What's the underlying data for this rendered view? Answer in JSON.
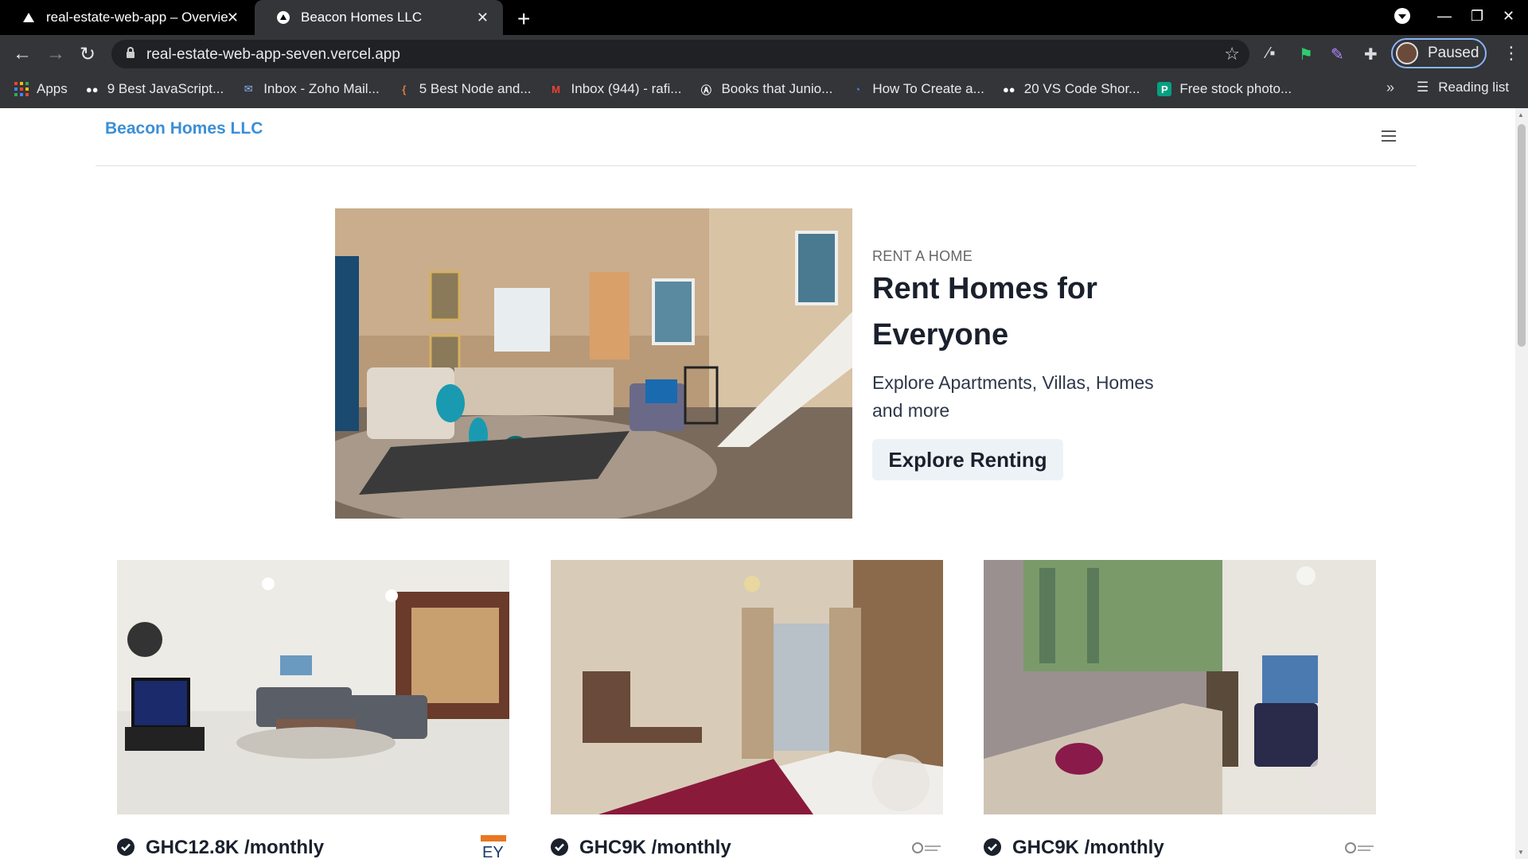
{
  "browser": {
    "tabs": [
      {
        "title": "real-estate-web-app – Overvie",
        "active": false
      },
      {
        "title": "Beacon Homes LLC",
        "active": true
      }
    ],
    "url": "real-estate-web-app-seven.vercel.app",
    "profile_label": "Paused",
    "bookmarks": [
      {
        "label": "Apps",
        "icon": "apps-grid-icon"
      },
      {
        "label": "9 Best JavaScript...",
        "icon": "medium-icon"
      },
      {
        "label": "Inbox - Zoho Mail...",
        "icon": "zoho-mail-icon"
      },
      {
        "label": "5 Best Node and...",
        "icon": "bookmark-icon"
      },
      {
        "label": "Inbox (944) - rafi...",
        "icon": "gmail-icon"
      },
      {
        "label": "Books that Junio...",
        "icon": "site-icon"
      },
      {
        "label": "How To Create a...",
        "icon": "site-icon"
      },
      {
        "label": "20 VS Code Shor...",
        "icon": "medium-icon"
      },
      {
        "label": "Free stock photo...",
        "icon": "pexels-icon"
      }
    ],
    "reading_list": "Reading list"
  },
  "site": {
    "brand": "Beacon Homes LLC",
    "hero": {
      "eyebrow": "RENT A HOME",
      "title": "Rent Homes for Everyone",
      "subtitle": "Explore Apartments, Villas, Homes and more",
      "cta": "Explore Renting"
    },
    "listings": [
      {
        "price": "GHC12.8K /monthly"
      },
      {
        "price": "GHC9K /monthly"
      },
      {
        "price": "GHC9K /monthly"
      }
    ]
  }
}
